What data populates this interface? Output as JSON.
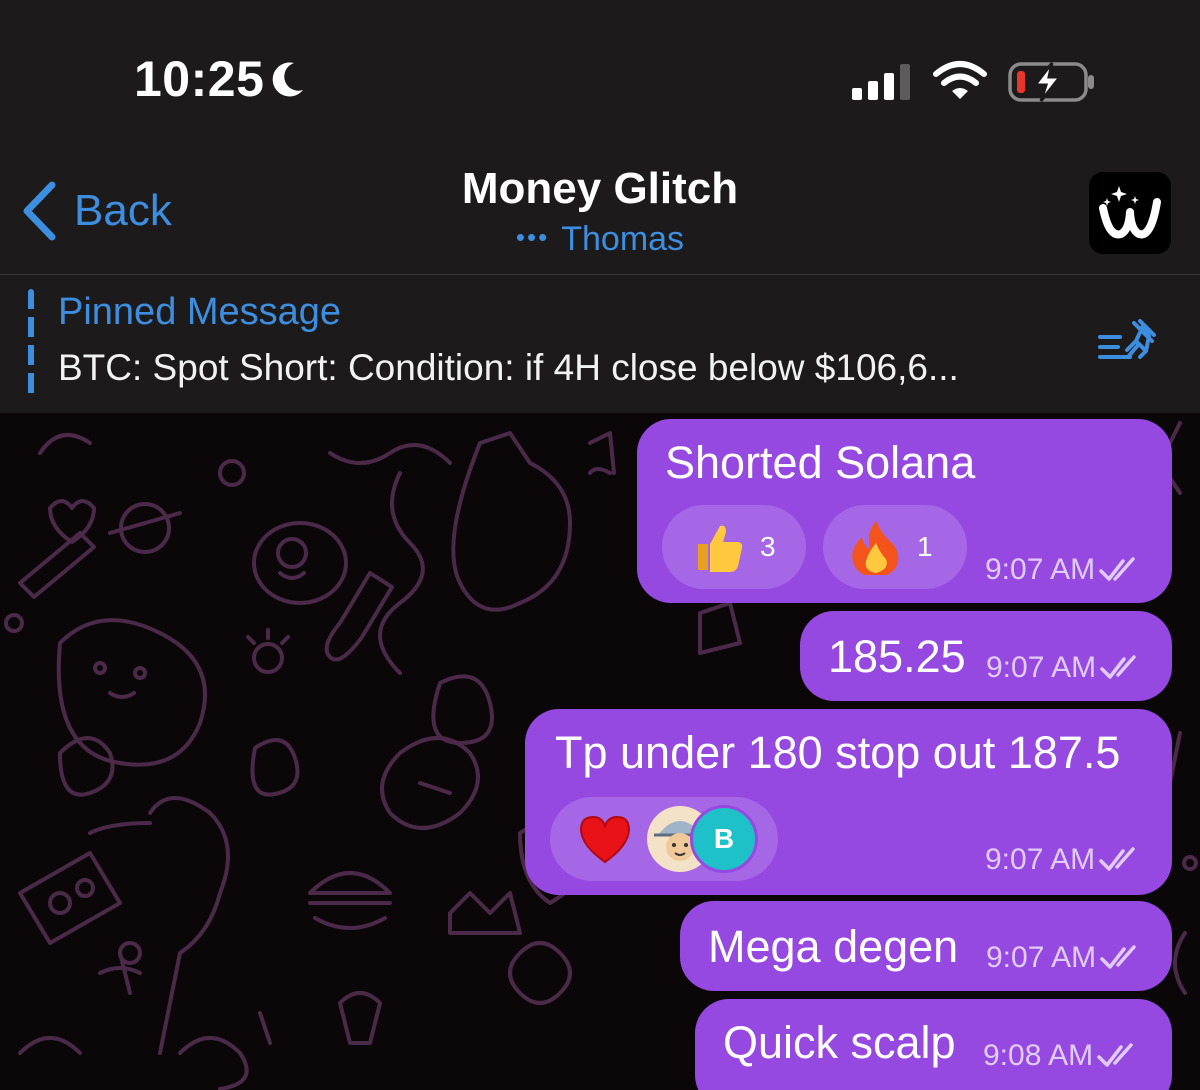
{
  "status_bar": {
    "time": "10:25",
    "icons": [
      "moon-icon",
      "signal-icon",
      "wifi-icon",
      "battery-charging-icon"
    ]
  },
  "nav": {
    "back_label": "Back",
    "title": "Money Glitch",
    "typing_dots": "•••",
    "typing_user": "Thomas"
  },
  "pinned": {
    "title": "Pinned Message",
    "text": "BTC: Spot Short: Condition: if 4H close below $106,6..."
  },
  "messages": [
    {
      "text": "Shorted Solana",
      "time": "9:07 AM",
      "reactions": [
        {
          "emoji": "thumbs-up",
          "count": "3"
        },
        {
          "emoji": "fire",
          "count": "1"
        }
      ]
    },
    {
      "text": "185.25",
      "time": "9:07 AM"
    },
    {
      "text": "Tp under 180 stop out 187.5",
      "time": "9:07 AM",
      "reactions": [
        {
          "emoji": "heart",
          "reactor_initial": "B"
        }
      ]
    },
    {
      "text": "Mega degen",
      "time": "9:07 AM"
    },
    {
      "text": "Quick scalp",
      "time": "9:08 AM"
    }
  ],
  "colors": {
    "accent": "#3e8ee0",
    "bubble": "#9549e1",
    "bar_bg": "#1c1a1b",
    "chat_bg": "#0b0709"
  }
}
